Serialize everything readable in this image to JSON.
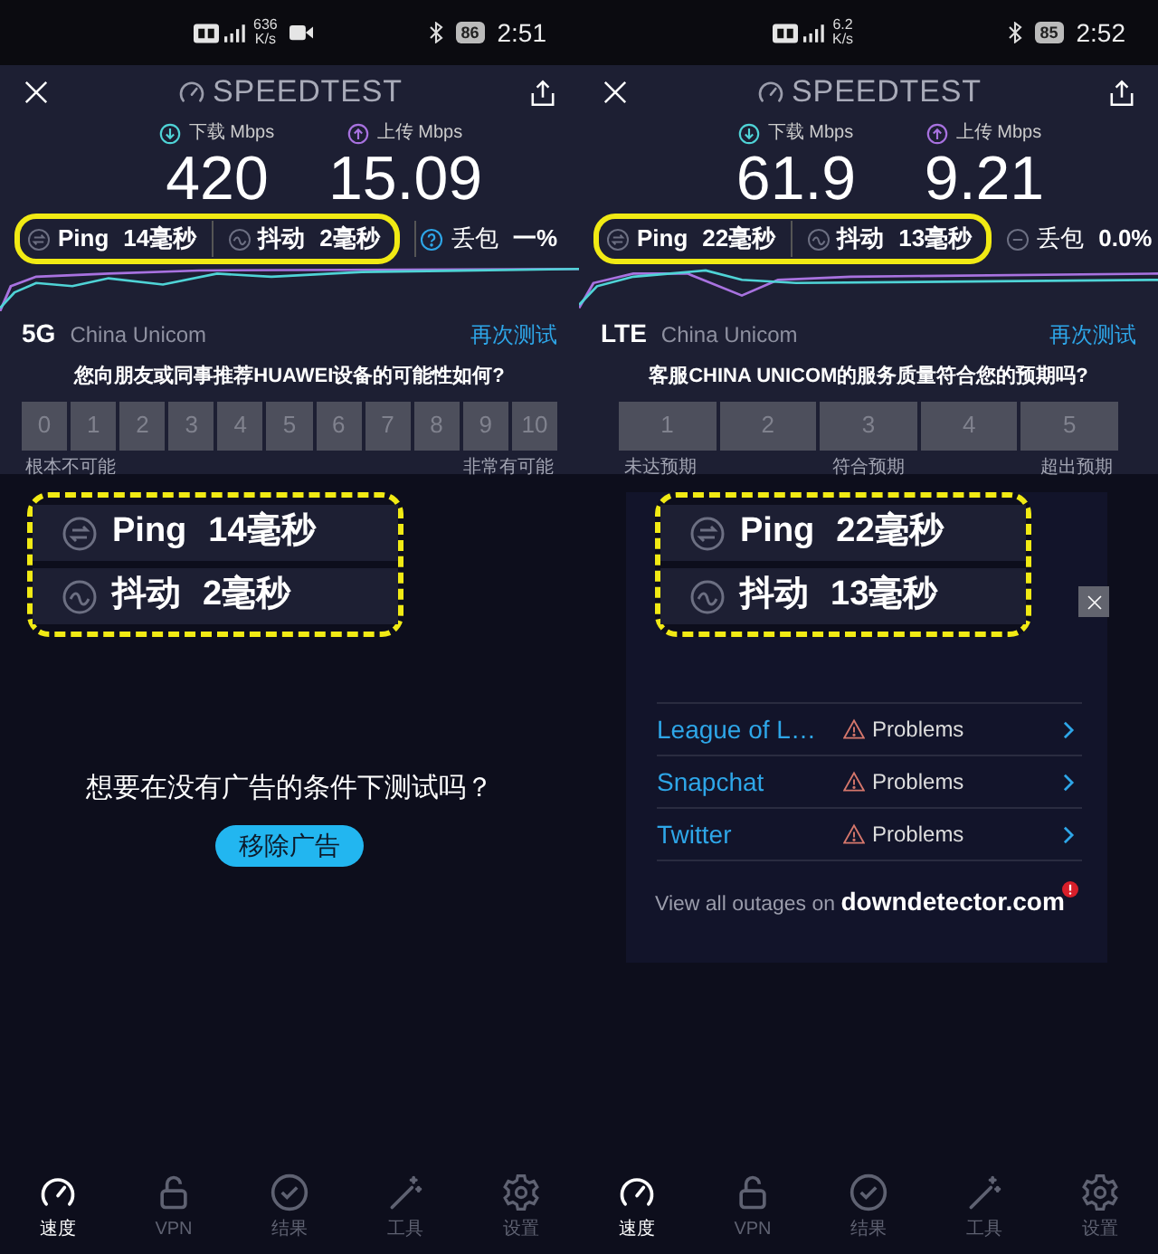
{
  "panels": [
    {
      "status_bar": {
        "speed": "636",
        "speed_unit": "K/s",
        "recording": true,
        "battery": "86",
        "time": "2:51"
      },
      "title": "SPEEDTEST",
      "download": {
        "label": "下载 Mbps",
        "value": "420"
      },
      "upload": {
        "label": "上传 Mbps",
        "value": "15.09"
      },
      "ping": {
        "label": "Ping",
        "value": "14毫秒"
      },
      "jitter": {
        "label": "抖动",
        "value": "2毫秒"
      },
      "packet_loss": {
        "kind": "help",
        "label": "丢包",
        "value": "一%"
      },
      "network": {
        "type": "5G",
        "carrier": "China Unicom"
      },
      "retest": "再次测试",
      "survey": {
        "question": "您向朋友或同事推荐HUAWEI设备的可能性如何?",
        "options": [
          "0",
          "1",
          "2",
          "3",
          "4",
          "5",
          "6",
          "7",
          "8",
          "9",
          "10"
        ],
        "scale_labels": [
          "根本不可能",
          "非常有可能"
        ]
      },
      "callout": {
        "ping": {
          "label": "Ping",
          "value": "14毫秒"
        },
        "jitter": {
          "label": "抖动",
          "value": "2毫秒"
        }
      },
      "promo": {
        "kind": "ad",
        "question": "想要在没有广告的条件下测试吗？",
        "button": "移除广告"
      },
      "nav": [
        {
          "kind": "gauge",
          "label": "速度",
          "selected": true
        },
        {
          "kind": "lock",
          "label": "VPN",
          "selected": false
        },
        {
          "kind": "check",
          "label": "结果",
          "selected": false
        },
        {
          "kind": "wand",
          "label": "工具",
          "selected": false
        },
        {
          "kind": "gear",
          "label": "设置",
          "selected": false
        }
      ]
    },
    {
      "status_bar": {
        "speed": "6.2",
        "speed_unit": "K/s",
        "recording": false,
        "battery": "85",
        "time": "2:52"
      },
      "title": "SPEEDTEST",
      "download": {
        "label": "下载 Mbps",
        "value": "61.9"
      },
      "upload": {
        "label": "上传 Mbps",
        "value": "9.21"
      },
      "ping": {
        "label": "Ping",
        "value": "22毫秒"
      },
      "jitter": {
        "label": "抖动",
        "value": "13毫秒"
      },
      "packet_loss": {
        "kind": "dash",
        "label": "丢包",
        "value": "0.0%"
      },
      "network": {
        "type": "LTE",
        "carrier": "China Unicom"
      },
      "retest": "再次测试",
      "survey": {
        "question": "客服CHINA UNICOM的服务质量符合您的预期吗?",
        "options": [
          "1",
          "2",
          "3",
          "4",
          "5"
        ],
        "scale_labels": [
          "未达预期",
          "符合预期",
          "超出预期"
        ]
      },
      "callout": {
        "ping": {
          "label": "Ping",
          "value": "22毫秒"
        },
        "jitter": {
          "label": "抖动",
          "value": "13毫秒"
        }
      },
      "promo": {
        "kind": "outages",
        "rows": [
          {
            "service": "League of L…",
            "status": "Problems"
          },
          {
            "service": "Snapchat",
            "status": "Problems"
          },
          {
            "service": "Twitter",
            "status": "Problems"
          }
        ],
        "footer": "View all outages on **downdetector.com**"
      },
      "nav": [
        {
          "kind": "gauge",
          "label": "速度",
          "selected": true
        },
        {
          "kind": "lock",
          "label": "VPN",
          "selected": false
        },
        {
          "kind": "check",
          "label": "结果",
          "selected": false
        },
        {
          "kind": "wand",
          "label": "工具",
          "selected": false
        },
        {
          "kind": "gear",
          "label": "设置",
          "selected": false
        }
      ]
    }
  ]
}
